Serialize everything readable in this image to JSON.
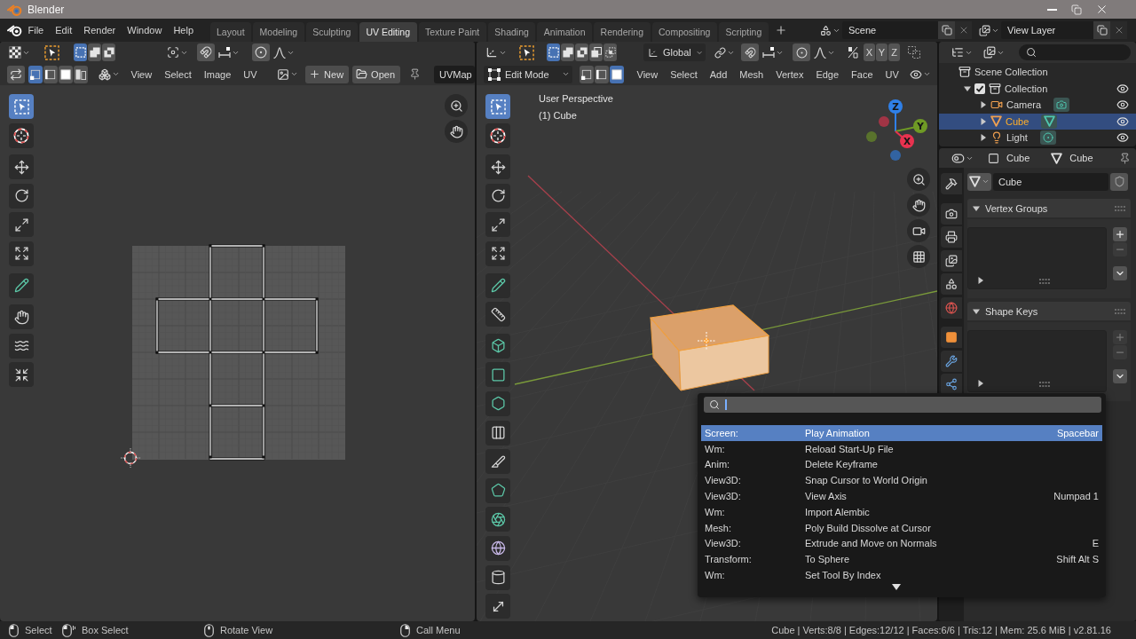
{
  "window": {
    "title": "Blender"
  },
  "top_bar": {
    "menus": [
      "File",
      "Edit",
      "Render",
      "Window",
      "Help"
    ],
    "workspaces": [
      {
        "label": "Layout",
        "selected": false
      },
      {
        "label": "Modeling",
        "selected": false
      },
      {
        "label": "Sculpting",
        "selected": false
      },
      {
        "label": "UV Editing",
        "selected": true
      },
      {
        "label": "Texture Paint",
        "selected": false
      },
      {
        "label": "Shading",
        "selected": false
      },
      {
        "label": "Animation",
        "selected": false
      },
      {
        "label": "Rendering",
        "selected": false
      },
      {
        "label": "Compositing",
        "selected": false
      },
      {
        "label": "Scripting",
        "selected": false
      }
    ],
    "scene": "Scene",
    "view_layer": "View Layer"
  },
  "uv_editor": {
    "box_modes": [
      {
        "kind": "set",
        "selected": true
      },
      {
        "kind": "extend",
        "selected": false
      },
      {
        "kind": "subtract",
        "selected": false
      }
    ],
    "snap": false,
    "proportional": false,
    "sync_selection": false,
    "select_modes": [
      {
        "kind": "vertex",
        "selected": true
      },
      {
        "kind": "edge",
        "selected": false
      },
      {
        "kind": "face",
        "selected": false
      },
      {
        "kind": "island",
        "selected": false
      }
    ],
    "menus": [
      "View",
      "Select",
      "Image",
      "UV"
    ],
    "new_button": "New",
    "open_button": "Open",
    "uv_map": "UVMap",
    "tools": [
      {
        "kind": "select-box",
        "selected": true
      },
      {
        "kind": "cursor",
        "selected": false
      },
      {
        "kind": "move",
        "selected": false
      },
      {
        "kind": "rotate",
        "selected": false
      },
      {
        "kind": "scale",
        "selected": false
      },
      {
        "kind": "transform",
        "selected": false
      },
      {
        "kind": "annotate",
        "selected": false
      },
      {
        "kind": "grab",
        "selected": false
      },
      {
        "kind": "relax",
        "selected": false
      },
      {
        "kind": "pinch",
        "selected": false
      }
    ]
  },
  "viewport": {
    "box_modes": [
      {
        "kind": "set",
        "selected": true
      },
      {
        "kind": "extend",
        "selected": false
      },
      {
        "kind": "subtract",
        "selected": false
      },
      {
        "kind": "difference",
        "selected": false
      },
      {
        "kind": "intersect",
        "selected": false
      }
    ],
    "orientation": "Global",
    "snap": false,
    "proportional": false,
    "mirror_axes": [
      {
        "label": "X",
        "selected": false
      },
      {
        "label": "Y",
        "selected": false
      },
      {
        "label": "Z",
        "selected": false
      }
    ],
    "mode": "Edit Mode",
    "select_modes": [
      {
        "kind": "vertex",
        "selected": false
      },
      {
        "kind": "edge",
        "selected": false
      },
      {
        "kind": "face",
        "selected": true
      }
    ],
    "menus": [
      "View",
      "Select",
      "Add",
      "Mesh",
      "Vertex",
      "Edge",
      "Face",
      "UV"
    ],
    "info": [
      "User Perspective",
      "(1) Cube"
    ],
    "gizmo": [
      {
        "label": "Z",
        "color": "#2f80e8"
      },
      {
        "label": "Y",
        "color": "#6f9a25"
      },
      {
        "label": "X",
        "color": "#e8324f"
      }
    ],
    "tools": [
      {
        "kind": "select-box",
        "selected": true
      },
      {
        "kind": "cursor",
        "selected": false
      },
      {
        "kind": "move",
        "selected": false
      },
      {
        "kind": "rotate",
        "selected": false
      },
      {
        "kind": "scale",
        "selected": false
      },
      {
        "kind": "transform",
        "selected": false
      },
      {
        "kind": "annotate",
        "selected": false
      },
      {
        "kind": "measure",
        "selected": false
      },
      {
        "kind": "extrude",
        "selected": false
      },
      {
        "kind": "inset",
        "selected": false
      },
      {
        "kind": "bevel",
        "selected": false
      },
      {
        "kind": "loop-cut",
        "selected": false
      },
      {
        "kind": "knife",
        "selected": false
      },
      {
        "kind": "poly-build",
        "selected": false
      },
      {
        "kind": "spin",
        "selected": false
      },
      {
        "kind": "smooth",
        "selected": false
      },
      {
        "kind": "shrink-fatten",
        "selected": false
      },
      {
        "kind": "shear",
        "selected": false
      }
    ]
  },
  "outliner": {
    "tree": [
      {
        "label": "Scene Collection",
        "kind": "collection",
        "children": [
          {
            "label": "Collection",
            "kind": "collection",
            "expanded": true,
            "checked": true,
            "visible": true,
            "children": [
              {
                "label": "Camera",
                "kind": "camera",
                "expanded": false,
                "selected": false,
                "visible": true
              },
              {
                "label": "Cube",
                "kind": "mesh",
                "expanded": false,
                "selected": true,
                "visible": true
              },
              {
                "label": "Light",
                "kind": "light",
                "expanded": false,
                "selected": false,
                "visible": true
              }
            ]
          }
        ]
      }
    ]
  },
  "properties": {
    "object": "Cube",
    "data": "Cube",
    "mesh_name": "Cube",
    "tabs": [
      {
        "kind": "tool",
        "selected": false
      },
      {
        "kind": "render",
        "selected": false
      },
      {
        "kind": "output",
        "selected": false
      },
      {
        "kind": "view-layer",
        "selected": false
      },
      {
        "kind": "scene",
        "selected": false
      },
      {
        "kind": "world",
        "selected": false
      },
      {
        "kind": "object",
        "selected": false
      },
      {
        "kind": "modifiers",
        "selected": false
      },
      {
        "kind": "particles",
        "selected": false
      }
    ],
    "panels": [
      {
        "title": "Vertex Groups",
        "expanded": true,
        "buttons": [
          {
            "kind": "add",
            "disabled": false
          },
          {
            "kind": "remove",
            "disabled": true
          },
          {
            "kind": "menu",
            "disabled": false
          }
        ]
      },
      {
        "title": "Shape Keys",
        "expanded": true,
        "buttons": [
          {
            "kind": "add",
            "disabled": true
          },
          {
            "kind": "remove",
            "disabled": true
          },
          {
            "kind": "menu",
            "disabled": false
          }
        ]
      }
    ]
  },
  "search_popup": {
    "results": [
      {
        "category": "Screen:",
        "name": "Play Animation",
        "shortcut": "Spacebar",
        "selected": true
      },
      {
        "category": "Wm:",
        "name": "Reload Start-Up File",
        "selected": false
      },
      {
        "category": "Anim:",
        "name": "Delete Keyframe",
        "selected": false
      },
      {
        "category": "View3D:",
        "name": "Snap Cursor to World Origin",
        "selected": false
      },
      {
        "category": "View3D:",
        "name": "View Axis",
        "shortcut": "Numpad 1",
        "selected": false
      },
      {
        "category": "Wm:",
        "name": "Import Alembic",
        "selected": false
      },
      {
        "category": "Mesh:",
        "name": "Poly Build Dissolve at Cursor",
        "selected": false
      },
      {
        "category": "View3D:",
        "name": "Extrude and Move on Normals",
        "shortcut": "E",
        "selected": false
      },
      {
        "category": "Transform:",
        "name": "To Sphere",
        "shortcut": "Shift Alt S",
        "selected": false
      },
      {
        "category": "Wm:",
        "name": "Set Tool By Index",
        "selected": false
      }
    ],
    "more_below": true
  },
  "status_bar": {
    "hints": [
      {
        "kind": "left",
        "label": "Select"
      },
      {
        "kind": "drag",
        "label": "Box Select"
      },
      {
        "kind": "middle",
        "label": "Rotate View"
      },
      {
        "kind": "right",
        "label": "Call Menu"
      }
    ],
    "stats": "Cube | Verts:8/8 | Edges:12/12 | Faces:6/6 | Tris:12 | Mem: 25.6 MiB | v2.81.16"
  }
}
